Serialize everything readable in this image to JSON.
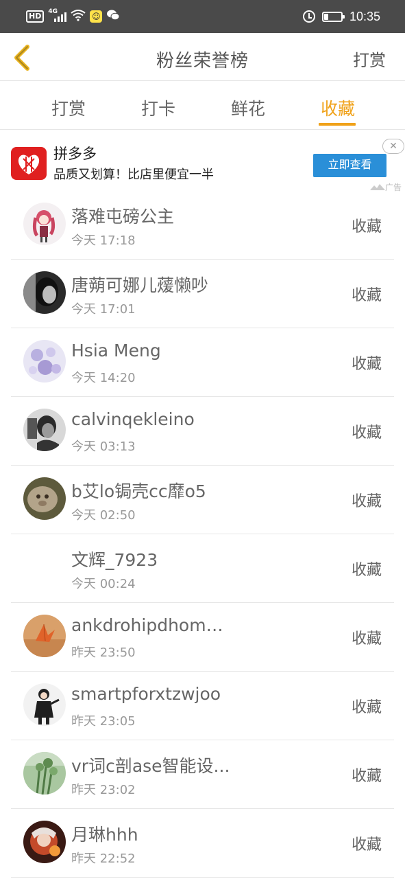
{
  "status_bar": {
    "hd": "HD",
    "network": "4G",
    "time": "10:35",
    "battery_level": 0.25
  },
  "header": {
    "title": "粉丝荣誉榜",
    "action": "打赏"
  },
  "tabs": [
    {
      "label": "打赏",
      "active": false
    },
    {
      "label": "打卡",
      "active": false
    },
    {
      "label": "鲜花",
      "active": false
    },
    {
      "label": "收藏",
      "active": true
    }
  ],
  "accent_color": "#f0a21a",
  "ad": {
    "title": "拼多多",
    "description": "品质又划算！比店里便宜一半",
    "button_label": "立即查看",
    "tag": "广告",
    "close_icon": "✕"
  },
  "list": [
    {
      "name": "落难屯磅公主",
      "time": "今天 17:18",
      "action": "收藏",
      "avatar": "avatar-pink-girl"
    },
    {
      "name": "唐蒴可娜儿蕿懒吵",
      "time": "今天 17:01",
      "action": "收藏",
      "avatar": "avatar-bw-portrait"
    },
    {
      "name": "Hsia Meng",
      "time": "今天 14:20",
      "action": "收藏",
      "avatar": "avatar-lavender-floral"
    },
    {
      "name": "calvinqekleino",
      "time": "今天 03:13",
      "action": "收藏",
      "avatar": "avatar-bw-thinking"
    },
    {
      "name": "b艾lo锔壳cc靡o5",
      "time": "今天 02:50",
      "action": "收藏",
      "avatar": "avatar-brown-plush"
    },
    {
      "name": "文辉_7923",
      "time": "今天 00:24",
      "action": "收藏",
      "avatar": ""
    },
    {
      "name": "ankdrohipdhomm...",
      "time": "昨天 23:50",
      "action": "收藏",
      "avatar": "avatar-sand-origami"
    },
    {
      "name": "smartpforxtzwjoo",
      "time": "昨天 23:05",
      "action": "收藏",
      "avatar": "avatar-anime-boy"
    },
    {
      "name": "vr词c剖ase智能设...",
      "time": "昨天 23:02",
      "action": "收藏",
      "avatar": "avatar-green-plants"
    },
    {
      "name": "月琳hhh",
      "time": "昨天 22:52",
      "action": "收藏",
      "avatar": "avatar-fire-girl"
    }
  ]
}
